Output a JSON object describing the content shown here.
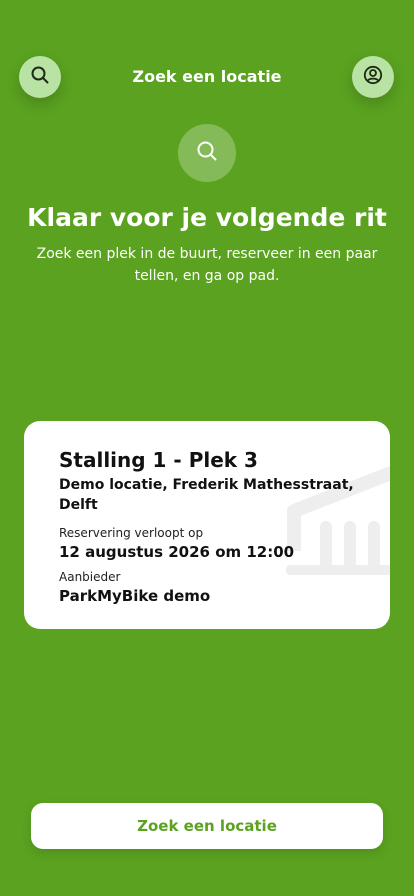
{
  "header": {
    "title": "Zoek een locatie",
    "search_icon": "search-icon",
    "profile_icon": "user-circle-icon"
  },
  "hero": {
    "icon": "search-icon",
    "title": "Klaar voor je volgende rit",
    "subtitle": "Zoek een plek in de buurt, reserveer in een paar tellen, en ga op pad."
  },
  "reservation": {
    "title": "Stalling 1 - Plek 3",
    "address": "Demo locatie, Frederik Mathesstraat, Delft",
    "expires_label": "Reservering verloopt op",
    "expires_value": "12 augustus 2026 om 12:00",
    "provider_label": "Aanbieder",
    "provider_value": "ParkMyBike demo",
    "watermark_icon": "bike-rack-icon"
  },
  "bottom_button": {
    "label": "Zoek een locatie"
  },
  "colors": {
    "background": "#5aa220",
    "header_button": "#b9e3a4",
    "hero_icon_bg": "#84bb58",
    "card": "#ffffff",
    "button_text": "#5aa220"
  }
}
